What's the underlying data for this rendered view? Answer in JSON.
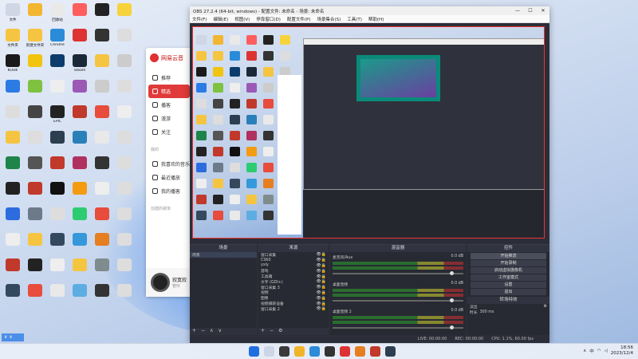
{
  "desktop": {
    "icons": [
      {
        "name": "文件",
        "color": "#cfd6e4"
      },
      {
        "name": "",
        "color": "#f2b632"
      },
      {
        "name": "回收站",
        "color": "#e9e9e9"
      },
      {
        "name": "",
        "color": "#ff5e5e"
      },
      {
        "name": "",
        "color": "#222"
      },
      {
        "name": "",
        "color": "#f6d33c"
      },
      {
        "name": "文件夹",
        "color": "#f5c542"
      },
      {
        "name": "新建文件夹",
        "color": "#f5c542"
      },
      {
        "name": "Chrome",
        "color": "#2a8bd8"
      },
      {
        "name": "",
        "color": "#d33"
      },
      {
        "name": "",
        "color": "#333"
      },
      {
        "name": "",
        "color": "#ddd"
      },
      {
        "name": "KOOK",
        "color": "#1a1a1a"
      },
      {
        "name": "",
        "color": "#f1c40f"
      },
      {
        "name": "",
        "color": "#0b3c6b"
      },
      {
        "name": "Steam",
        "color": "#1b2838"
      },
      {
        "name": "",
        "color": "#f5c542"
      },
      {
        "name": "",
        "color": "#ccc"
      },
      {
        "name": "",
        "color": "#2c7be5"
      },
      {
        "name": "",
        "color": "#7fc241"
      },
      {
        "name": "",
        "color": "#eee"
      },
      {
        "name": "",
        "color": "#9b59b6"
      },
      {
        "name": "",
        "color": "#ccc"
      },
      {
        "name": "",
        "color": "#ddd"
      },
      {
        "name": "",
        "color": "#ddd"
      },
      {
        "name": "",
        "color": "#444"
      },
      {
        "name": "EPIC",
        "color": "#222"
      },
      {
        "name": "",
        "color": "#c0392b"
      },
      {
        "name": "",
        "color": "#e74c3c"
      },
      {
        "name": "",
        "color": "#eee"
      },
      {
        "name": "",
        "color": "#f5c542"
      },
      {
        "name": "",
        "color": "#ddd"
      },
      {
        "name": "",
        "color": "#2c3e50"
      },
      {
        "name": "",
        "color": "#2980b9"
      },
      {
        "name": "",
        "color": "#e9e9e9"
      },
      {
        "name": "",
        "color": "#ddd"
      },
      {
        "name": "",
        "color": "#1e8449"
      },
      {
        "name": "",
        "color": "#555"
      },
      {
        "name": "",
        "color": "#c0392b"
      },
      {
        "name": "",
        "color": "#b03060"
      },
      {
        "name": "",
        "color": "#333"
      },
      {
        "name": "",
        "color": "#ddd"
      },
      {
        "name": "",
        "color": "#222"
      },
      {
        "name": "",
        "color": "#c0392b"
      },
      {
        "name": "",
        "color": "#111"
      },
      {
        "name": "",
        "color": "#f39c12"
      },
      {
        "name": "",
        "color": "#eee"
      },
      {
        "name": "",
        "color": "#ddd"
      },
      {
        "name": "",
        "color": "#2d6cdf"
      },
      {
        "name": "",
        "color": "#6c7a89"
      },
      {
        "name": "",
        "color": "#ddd"
      },
      {
        "name": "",
        "color": "#2ecc71"
      },
      {
        "name": "",
        "color": "#e74c3c"
      },
      {
        "name": "",
        "color": "#ddd"
      },
      {
        "name": "",
        "color": "#eee"
      },
      {
        "name": "",
        "color": "#f5c542"
      },
      {
        "name": "",
        "color": "#34495e"
      },
      {
        "name": "",
        "color": "#3498db"
      },
      {
        "name": "",
        "color": "#e67e22"
      },
      {
        "name": "",
        "color": "#ddd"
      },
      {
        "name": "",
        "color": "#c0392b"
      },
      {
        "name": "",
        "color": "#222"
      },
      {
        "name": "",
        "color": "#eee"
      },
      {
        "name": "",
        "color": "#f5c542"
      },
      {
        "name": "",
        "color": "#7f8c8d"
      },
      {
        "name": "",
        "color": "#ddd"
      },
      {
        "name": "",
        "color": "#34495e"
      },
      {
        "name": "",
        "color": "#e74c3c"
      },
      {
        "name": "",
        "color": "#e9e9e9"
      },
      {
        "name": "",
        "color": "#5dade2"
      },
      {
        "name": "",
        "color": "#333"
      },
      {
        "name": "",
        "color": "#ddd"
      }
    ]
  },
  "music_app": {
    "title": "网易云音",
    "nav": [
      {
        "label": "推荐"
      },
      {
        "label": "精选",
        "active": true
      },
      {
        "label": "播客"
      },
      {
        "label": "漫游"
      },
      {
        "label": "关注"
      }
    ],
    "section_mine": "我的",
    "mine": [
      {
        "label": "我喜欢的音乐"
      },
      {
        "label": "最近播放"
      },
      {
        "label": "我的播客"
      }
    ],
    "playlists_label": "创建的歌单",
    "now_playing": {
      "title": "寂寞寂",
      "artist": "管玲"
    }
  },
  "obs": {
    "title": "OBS 27.2.4 (64-bit, windows) - 配置文件: 未命名 - 场景: 未命名",
    "menu": [
      "文件(F)",
      "编辑(E)",
      "视图(V)",
      "停靠窗口(D)",
      "配置文件(P)",
      "场景集合(S)",
      "工具(T)",
      "帮助(H)"
    ],
    "docks": {
      "scenes_header": "场景",
      "scenes": [
        "场景"
      ],
      "sources_header": "来源",
      "sources": [
        "窗口采集",
        "CS60",
        "yxly",
        "游戏",
        "工具箱",
        "文字 (GDI+)",
        "窗口采集 3",
        "视频",
        "图像",
        "视频捕获设备",
        "窗口采集 2"
      ],
      "mixer_header": "混音器",
      "mixer": [
        {
          "name": "麦克风/Aux",
          "db": "0.0 dB"
        },
        {
          "name": "桌面音频",
          "db": "0.0 dB"
        },
        {
          "name": "桌面音频 2",
          "db": "0.0 dB"
        }
      ],
      "transitions_header": "转场特效",
      "transition_type": "淡出",
      "duration_label": "时长",
      "duration_value": "300 ms",
      "controls_header": "控件",
      "controls": [
        "开始推流",
        "开始录制",
        "启动虚拟摄像机",
        "工作室模式",
        "设置",
        "退出"
      ]
    },
    "tabs": {
      "filters": "滤镜",
      "props": "属性"
    },
    "status": {
      "live": "LIVE: 00:00:00",
      "rec": "REC: 00:00:00",
      "cpu": "CPU: 1.1%, 60.00 fps"
    }
  },
  "taskbar": {
    "time": "18:56",
    "date": "2023/12/4",
    "lang": "中"
  }
}
